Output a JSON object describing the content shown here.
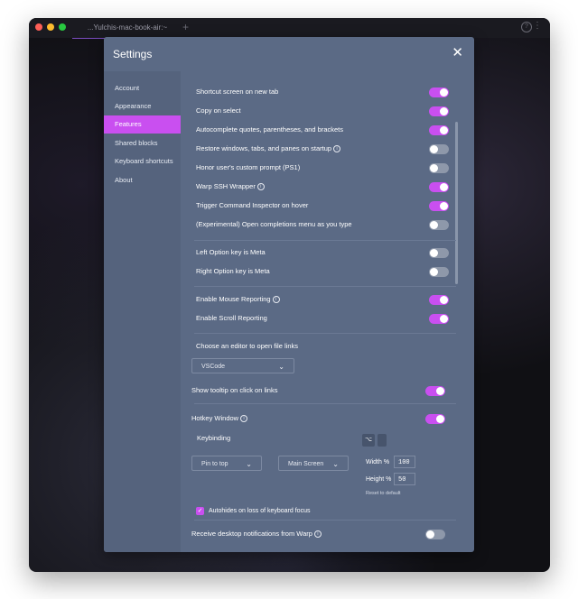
{
  "titlebar": {
    "tab_label": "...Yulchis-mac-book-air:~",
    "plus_label": "+",
    "help_label": "?",
    "kebab_label": "⋮"
  },
  "settings": {
    "title": "Settings",
    "close_label": "✕",
    "sidebar": [
      {
        "label": "Account",
        "active": false
      },
      {
        "label": "Appearance",
        "active": false
      },
      {
        "label": "Features",
        "active": true
      },
      {
        "label": "Shared blocks",
        "active": false
      },
      {
        "label": "Keyboard shortcuts",
        "active": false
      },
      {
        "label": "About",
        "active": false
      }
    ],
    "features": {
      "toggles": [
        {
          "label": "Shortcut screen on new tab",
          "on": true
        },
        {
          "label": "Copy on select",
          "on": true
        },
        {
          "label": "Autocomplete quotes, parentheses, and brackets",
          "on": true
        },
        {
          "label": "Restore windows, tabs, and panes on startup",
          "on": false,
          "info": true
        },
        {
          "label": "Honor user's custom prompt (PS1)",
          "on": false
        },
        {
          "label": "Warp SSH Wrapper",
          "on": true,
          "info": true
        },
        {
          "label": "Trigger Command Inspector on hover",
          "on": true
        },
        {
          "label": "(Experimental) Open completions menu as you type",
          "on": false
        },
        {
          "label": "Left Option key is Meta",
          "on": false
        },
        {
          "label": "Right Option key is Meta",
          "on": false
        },
        {
          "label": "Enable Mouse Reporting",
          "on": true,
          "info": true
        },
        {
          "label": "Enable Scroll Reporting",
          "on": true
        }
      ],
      "editor_label": "Choose an editor to open file links",
      "editor_value": "VSCode",
      "tooltip_label": "Show tooltip on click on links",
      "tooltip_on": true,
      "hotkey_label": "Hotkey Window",
      "hotkey_on": true,
      "keybinding_label": "Keybinding",
      "keybinding_key": "⌥",
      "pin_value": "Pin to top",
      "screen_value": "Main Screen",
      "width_label": "Width %",
      "width_value": "100",
      "height_label": "Height %",
      "height_value": "50",
      "reset_label": "Reset to default",
      "autohide_label": "Autohides on loss of keyboard focus",
      "autohide_checked": true,
      "notifications_label": "Receive desktop notifications from Warp",
      "notifications_on": false
    }
  }
}
